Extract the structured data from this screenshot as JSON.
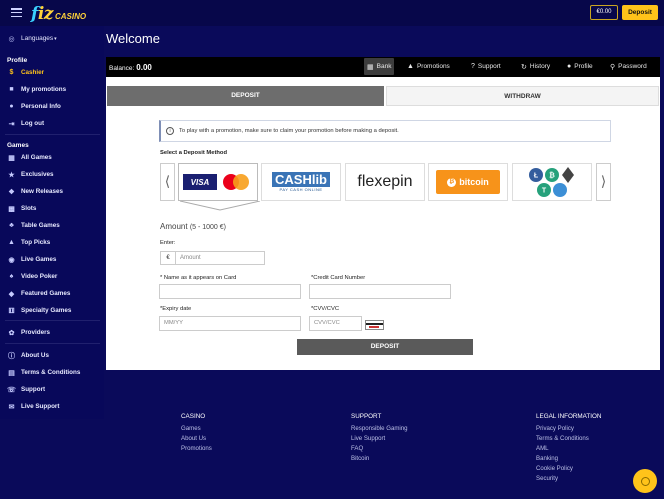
{
  "header": {
    "logo_text": "fiz",
    "logo_sub": "CASINO",
    "balance": "€0.00",
    "deposit_label": "Deposit"
  },
  "sidebar": {
    "languages": "Languages",
    "profile_heading": "Profile",
    "profile_items": [
      {
        "label": "Cashier",
        "icon": "dollar-icon"
      },
      {
        "label": "My promotions",
        "icon": "gift-icon"
      },
      {
        "label": "Personal Info",
        "icon": "user-icon"
      },
      {
        "label": "Log out",
        "icon": "logout-icon"
      }
    ],
    "games_heading": "Games",
    "game_items": [
      {
        "label": "All Games",
        "icon": "grid-icon"
      },
      {
        "label": "Exclusives",
        "icon": "star-icon"
      },
      {
        "label": "New Releases",
        "icon": "new-icon"
      },
      {
        "label": "Slots",
        "icon": "slots-icon"
      },
      {
        "label": "Table Games",
        "icon": "table-icon"
      },
      {
        "label": "Top Picks",
        "icon": "thumb-icon"
      },
      {
        "label": "Live Games",
        "icon": "live-icon"
      },
      {
        "label": "Video Poker",
        "icon": "cards-icon"
      },
      {
        "label": "Featured Games",
        "icon": "feature-icon"
      },
      {
        "label": "Specialty Games",
        "icon": "dice-icon"
      }
    ],
    "providers": "Providers",
    "info_items": [
      {
        "label": "About Us",
        "icon": "info-icon"
      },
      {
        "label": "Terms & Conditions",
        "icon": "doc-icon"
      },
      {
        "label": "Support",
        "icon": "support-icon"
      },
      {
        "label": "Live Support",
        "icon": "chat-icon"
      }
    ]
  },
  "page": {
    "title": "Welcome"
  },
  "cashier_bar": {
    "balance_label": "Balance:",
    "balance_value": "0.00",
    "nav": [
      {
        "label": "Bank",
        "icon": "bank-icon"
      },
      {
        "label": "Promotions",
        "icon": "megaphone-icon"
      },
      {
        "label": "Support",
        "icon": "question-icon"
      },
      {
        "label": "History",
        "icon": "history-icon"
      },
      {
        "label": "Profile",
        "icon": "user-icon"
      },
      {
        "label": "Password",
        "icon": "key-icon"
      }
    ]
  },
  "cashier": {
    "tab_deposit": "DEPOSIT",
    "tab_withdraw": "WITHDRAW",
    "notice": "To play with a promotion, make sure to claim your promotion before making a deposit.",
    "method_label": "Select a Deposit Method",
    "methods": {
      "visa": "VISA",
      "cashlib": "CASHlib",
      "cashlib_sub": "PAY CASH ONLINE",
      "flexepin": "flexepin",
      "bitcoin": "bitcoin"
    },
    "amount_title": "Amount",
    "amount_range": "(5 - 1000 €)",
    "enter_label": "Enter:",
    "currency": "€",
    "amount_placeholder": "Amount",
    "name_label": "* Name as it appears on Card",
    "card_label": "*Credit Card Number",
    "expiry_label": "*Expiry date",
    "expiry_placeholder": "MM/YY",
    "cvv_label": "*CVV/CVC",
    "cvv_placeholder": "CVV/CVC",
    "submit": "DEPOSIT"
  },
  "footer": {
    "casino_heading": "CASINO",
    "casino_links": [
      "Games",
      "About Us",
      "Promotions"
    ],
    "support_heading": "SUPPORT",
    "support_links": [
      "Responsible Gaming",
      "Live Support",
      "FAQ",
      "Bitcoin"
    ],
    "legal_heading": "LEGAL INFORMATION",
    "legal_links": [
      "Privacy Policy",
      "Terms & Conditions",
      "AML",
      "Banking",
      "Cookie Policy",
      "Security"
    ]
  },
  "colors": {
    "background": "#0a0a5a",
    "accent": "#ffc31a",
    "panel": "#ffffff"
  }
}
